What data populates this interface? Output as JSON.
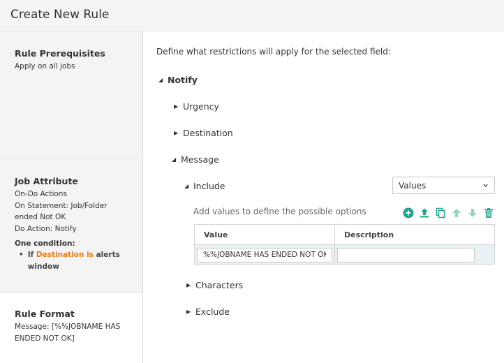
{
  "header": {
    "title": "Create New Rule"
  },
  "sidebar": {
    "prerequisites": {
      "title": "Rule Prerequisites",
      "text": "Apply on all jobs"
    },
    "job_attribute": {
      "title": "Job Attribute",
      "lines": [
        "On-Do Actions",
        "On Statement: Job/Folder",
        "ended Not OK",
        "Do Action: Notify"
      ],
      "condition_heading": "One condition:",
      "condition": {
        "prefix": "If",
        "highlight": "Destination is",
        "suffix": "alerts",
        "line2": "window"
      }
    },
    "rule_format": {
      "title": "Rule Format",
      "lines": [
        "Message: [%%JOBNAME HAS",
        "ENDED NOT OK]"
      ]
    }
  },
  "main": {
    "intro": "Define what restrictions will apply for the selected field:",
    "tree": {
      "notify": "Notify",
      "urgency": "Urgency",
      "destination": "Destination",
      "message": "Message",
      "include": "Include",
      "characters": "Characters",
      "exclude": "Exclude"
    },
    "include_select": {
      "value": "Values"
    },
    "add_values_text": "Add values to define the possible options",
    "toolbar_icons": [
      "add-icon",
      "upload-icon",
      "copy-icon",
      "arrow-up-icon",
      "arrow-down-icon",
      "trash-icon"
    ],
    "table": {
      "columns": [
        "Value",
        "Description"
      ],
      "rows": [
        {
          "value": "%%JOBNAME HAS ENDED NOT OK",
          "description": ""
        }
      ]
    }
  },
  "colors": {
    "accent": "#1aa58a",
    "accent_light": "#8fd8c6",
    "highlight": "#f07b10"
  }
}
